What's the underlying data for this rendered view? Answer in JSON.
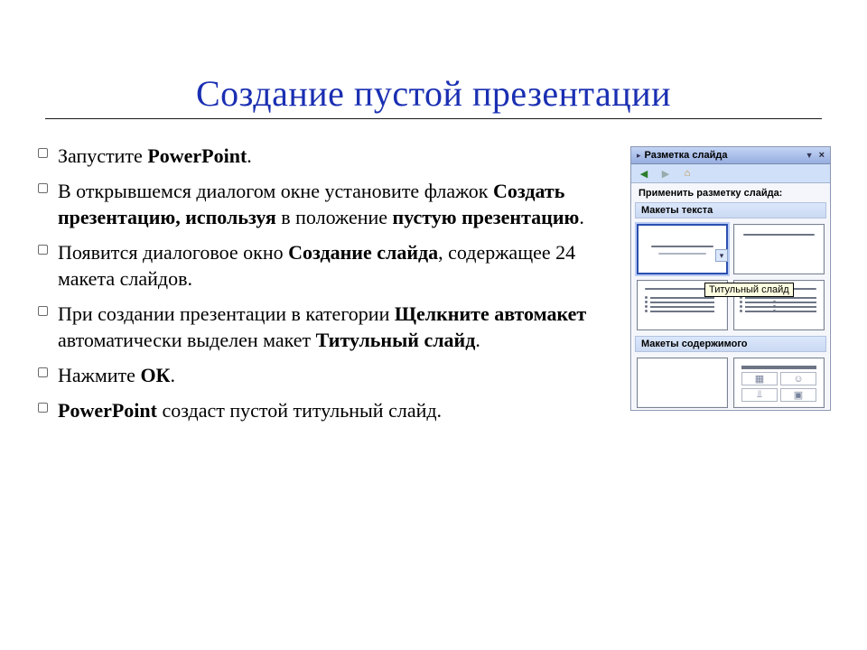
{
  "title": "Создание пустой презентации",
  "bullets": [
    {
      "pre": "Запустите ",
      "b1": "PowerPoint",
      "post": "."
    },
    {
      "pre": "В открывшемся диалогом окне установите флажок ",
      "b1": "Создать презентацию, используя",
      "mid": " в положение ",
      "b2": "пустую презентацию",
      "post": "."
    },
    {
      "pre": "Появится диалоговое окно ",
      "b1": "Создание слайда",
      "post": ", содержащее 24 макета слайдов."
    },
    {
      "pre": "При создании презентации в категории ",
      "b1": "Щелкните автомакет",
      "mid": " автоматически выделен макет ",
      "b2": "Титульный слайд",
      "post": "."
    },
    {
      "pre": "Нажмите ",
      "b1": "ОК",
      "post": "."
    },
    {
      "b1": "PowerPoint",
      "post": " создаст пустой титульный слайд."
    }
  ],
  "pane": {
    "title": "Разметка слайда",
    "subtitle": "Применить разметку слайда:",
    "section1": "Макеты текста",
    "section2": "Макеты содержимого",
    "tooltip": "Титульный слайд"
  }
}
